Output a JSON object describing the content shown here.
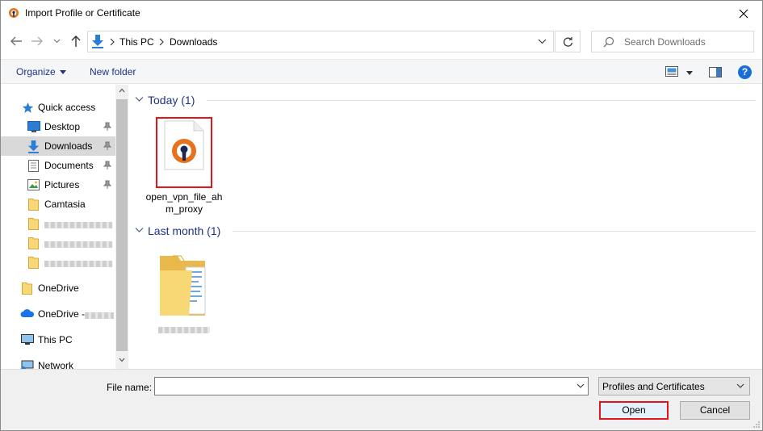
{
  "window": {
    "title": "Import Profile or Certificate"
  },
  "address": {
    "crumbs": [
      "This PC",
      "Downloads"
    ]
  },
  "search": {
    "placeholder": "Search Downloads"
  },
  "toolbar": {
    "organize": "Organize",
    "new_folder": "New folder",
    "help": "?"
  },
  "navpane": {
    "items": [
      {
        "label": "Quick access"
      },
      {
        "label": "Desktop"
      },
      {
        "label": "Downloads"
      },
      {
        "label": "Documents"
      },
      {
        "label": "Pictures"
      },
      {
        "label": "Camtasia"
      },
      {
        "label": "OneDrive"
      },
      {
        "label": "OneDrive - "
      },
      {
        "label": "This PC"
      },
      {
        "label": "Network"
      }
    ],
    "selected": "Downloads"
  },
  "content": {
    "groups": [
      {
        "label": "Today (1)",
        "files": [
          {
            "name": "open_vpn_file_ahm_proxy",
            "icon": "openvpn-file-icon"
          }
        ]
      },
      {
        "label": "Last month (1)",
        "files": [
          {
            "name": "",
            "icon": "folder-icon"
          }
        ]
      }
    ]
  },
  "bottom": {
    "file_name_label": "File name:",
    "file_name_value": "",
    "filter": "Profiles and Certificates",
    "open_label": "Open",
    "cancel_label": "Cancel"
  },
  "colors": {
    "accent": "#1e3287",
    "highlight": "#e0161b",
    "openvpn_orange": "#e8721c",
    "openvpn_navy": "#1b2950"
  }
}
